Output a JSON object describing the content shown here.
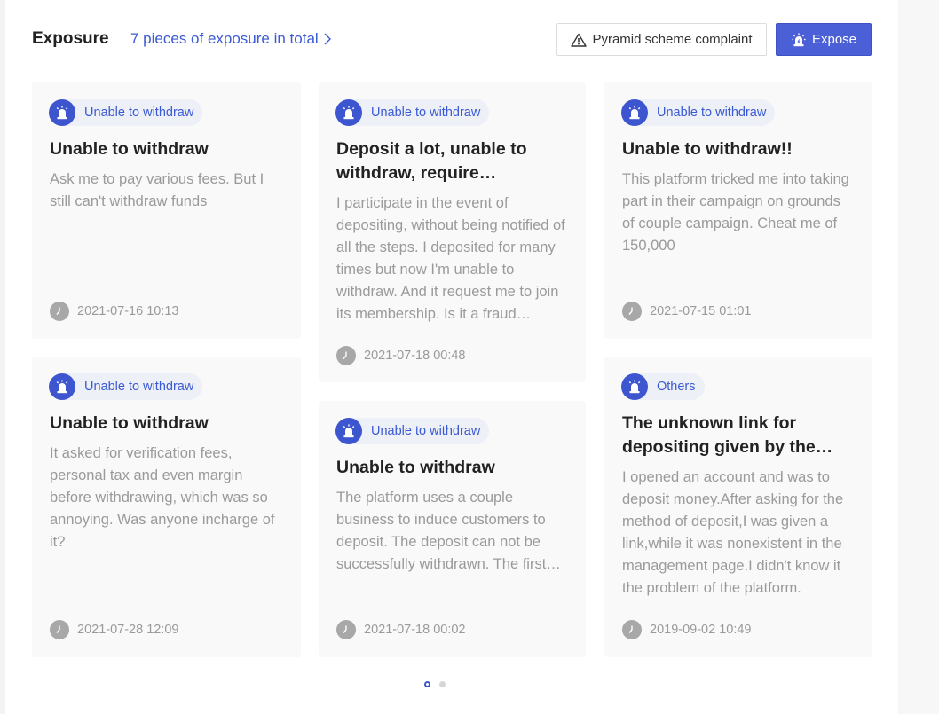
{
  "header": {
    "title": "Exposure",
    "count_link": "7 pieces of exposure in total",
    "complaint_button": "Pyramid scheme complaint",
    "expose_button": "Expose"
  },
  "colors": {
    "accent": "#4b5fd6",
    "link": "#3a5ad4",
    "muted_text": "#9a9a9a",
    "card_bg": "#f9f9fa"
  },
  "icons": {
    "tag_badge": "alarm-icon",
    "time": "clock-icon",
    "complaint": "warning-icon",
    "count_link": "chevron-right-icon"
  },
  "cards": [
    {
      "tag": "Unable to withdraw",
      "title": "Unable to withdraw",
      "description": "Ask me to pay various fees. But I still can't withdraw funds",
      "time": "2021-07-16 10:13"
    },
    {
      "tag": "Unable to withdraw",
      "title": "Deposit a lot, unable to withdraw, require membership fees",
      "description": "I participate in the event of depositing, without being notified of all the steps. I deposited for many times but now I'm unable to withdraw. And it request me to join its membership. Is it a fraud platform?",
      "time": "2021-07-18 00:48"
    },
    {
      "tag": "Unable to withdraw",
      "title": "Unable to withdraw!!",
      "description": "This platform tricked me into taking part in their campaign on grounds of couple campaign. Cheat me of 150,000",
      "time": "2021-07-15 01:01"
    },
    {
      "tag": "Unable to withdraw",
      "title": "Unable to withdraw",
      "description": "It asked for verification fees, personal tax and even margin before withdrawing, which was so annoying. Was anyone incharge of it?",
      "time": "2021-07-28 12:09"
    },
    {
      "tag": "Unable to withdraw",
      "title": "Unable to withdraw",
      "description": "The platform uses a couple business to induce customers to deposit. The deposit can not be successfully withdrawn. The first time I deposited it was fine.",
      "time": "2021-07-18 00:02"
    },
    {
      "tag": "Others",
      "title": "The unknown link for depositing given by the platform",
      "description": "I opened an account and was to deposit money.After asking for the method of deposit,I was given a link,while it was nonexistent in the management page.I didn't know it the problem of the platform.",
      "time": "2019-09-02 10:49"
    }
  ],
  "pagination": {
    "total_pages": 2,
    "current_page": 1
  }
}
